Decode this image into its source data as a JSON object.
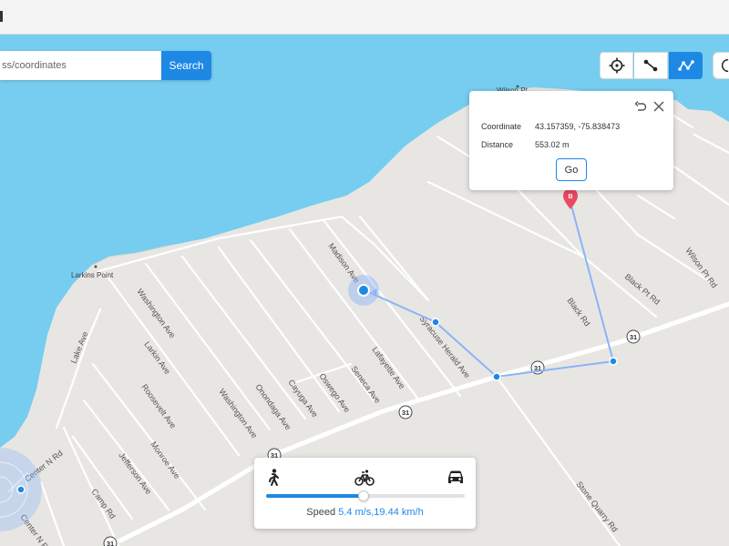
{
  "search": {
    "placeholder": "ss/coordinates",
    "button_label": "Search"
  },
  "toolbar": {
    "buttons": [
      {
        "name": "teleport",
        "icon": "crosshair-icon",
        "active": false
      },
      {
        "name": "two-spot-route",
        "icon": "two-point-route-icon",
        "active": false
      },
      {
        "name": "multi-spot-route",
        "icon": "multi-point-route-icon",
        "active": true
      },
      {
        "name": "joystick",
        "icon": "joystick-icon",
        "active": false
      }
    ]
  },
  "popup": {
    "coordinate_label": "Coordinate",
    "coordinate_value": "43.157359, -75.838473",
    "distance_label": "Distance",
    "distance_value": "553.02 m",
    "go_label": "Go"
  },
  "speed": {
    "label": "Speed",
    "value_text": "5.4 m/s,19.44 km/h",
    "slider_fraction": 0.49,
    "modes": [
      "walk-icon",
      "bicycle-icon",
      "car-icon"
    ]
  },
  "map": {
    "place_labels": [
      "Larkins Point",
      "Wilson Pt"
    ],
    "road_labels": [
      "Madison Ave",
      "Lafayette Ave",
      "Seneca Ave",
      "Oswego Ave",
      "Cayuga Ave",
      "Onondaga Ave",
      "Washington Ave",
      "Roosevelt Ave",
      "Larkin Ave",
      "Lake Ave",
      "Monroe Ave",
      "Jefferson Ave",
      "Camp Rd",
      "Center N Rd",
      "Syracuse Herald Ave",
      "Black Rd",
      "Black Pt Rd",
      "Wilson Pt Rd",
      "Stone Quarry Rd"
    ],
    "route_shields": [
      "31",
      "31",
      "31",
      "31",
      "31"
    ],
    "colors": {
      "water": "#76cdef",
      "land": "#e8e6e3",
      "road": "#ffffff",
      "route": "#8ab4f8",
      "accent": "#1e88e5",
      "pin": "#e84a5f"
    }
  }
}
